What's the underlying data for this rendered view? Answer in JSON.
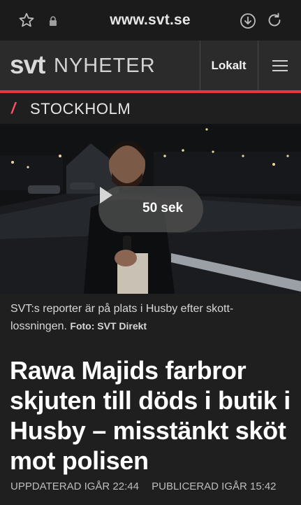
{
  "browser": {
    "url": "www.svt.se",
    "icons": [
      "star-icon",
      "lock-icon",
      "download-icon",
      "reload-icon"
    ]
  },
  "header": {
    "logo": "svt",
    "section": "NYHETER",
    "lokalt_label": "Lokalt",
    "menu_icon": "hamburger-menu-icon",
    "accent_color": "#e0393e"
  },
  "strip": {
    "slash": "/",
    "title": "STOCKHOLM",
    "slash_color": "#ff4f6a"
  },
  "video": {
    "duration_label": "50 sek",
    "play_icon": "play-icon"
  },
  "caption": {
    "text": "SVT:s reporter är på plats i Husby efter skott-lossningen.",
    "credit": "Foto: SVT Direkt"
  },
  "article": {
    "headline": "Rawa Majids farbror skjuten till döds i butik i Husby – misstänkt sköt mot polisen",
    "updated": "UPPDATERAD IGÅR 22:44",
    "published": "PUBLICERAD IGÅR 15:42"
  }
}
